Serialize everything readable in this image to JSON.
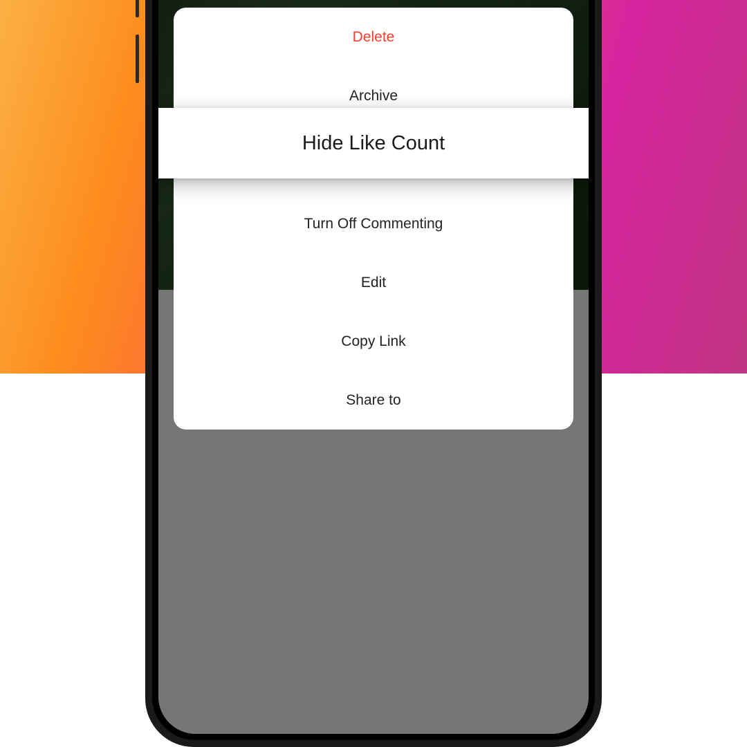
{
  "actionSheet": {
    "items": {
      "delete": "Delete",
      "archive": "Archive",
      "hideLikeCount": "Hide Like Count",
      "turnOffCommenting": "Turn Off Commenting",
      "edit": "Edit",
      "copyLink": "Copy Link",
      "shareTo": "Share to"
    }
  },
  "colors": {
    "destructive": "#ff3b30",
    "text": "#222222"
  }
}
